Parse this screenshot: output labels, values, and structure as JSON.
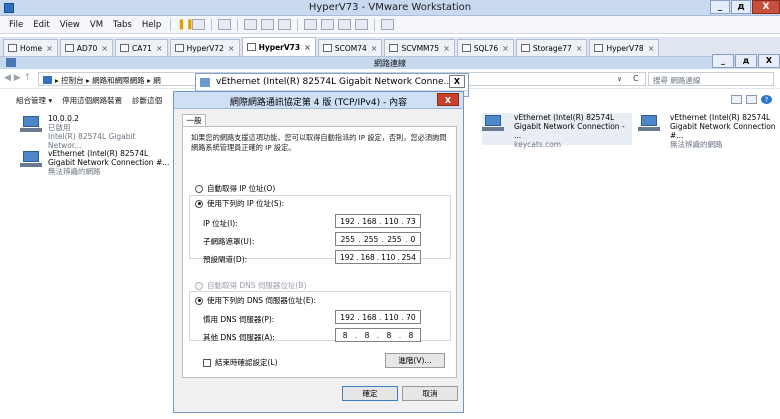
{
  "vmware": {
    "title": "HyperV73 - VMware Workstation",
    "window_controls": {
      "minimize": "_",
      "maximize": "д",
      "close": "X"
    },
    "menu": [
      "File",
      "Edit",
      "View",
      "VM",
      "Tabs",
      "Help"
    ],
    "tabs": [
      {
        "label": "Home",
        "active": false
      },
      {
        "label": "AD70",
        "active": false
      },
      {
        "label": "CA71",
        "active": false
      },
      {
        "label": "HyperV72",
        "active": false
      },
      {
        "label": "HyperV73",
        "active": true
      },
      {
        "label": "SCOM74",
        "active": false
      },
      {
        "label": "SCVMM75",
        "active": false
      },
      {
        "label": "SQL76",
        "active": false
      },
      {
        "label": "Storage77",
        "active": false
      },
      {
        "label": "HyperV78",
        "active": false
      }
    ],
    "tab_close": "×"
  },
  "explorer": {
    "title": "網路連線",
    "window_controls": {
      "minimize": "_",
      "maximize": "д",
      "close": "X"
    },
    "nav": "◀ ▶ ↑",
    "address": "▸ 控制台 ▸ 網路和網際網路 ▸ 網",
    "address_dropdown": "∨",
    "address_refresh": "С",
    "search_placeholder": "搜尋 網路連線",
    "commands": [
      "組合管理 ▾",
      "停用這個網路裝置",
      "診斷這個"
    ],
    "help_label": "?",
    "adapters": [
      {
        "line1": "10.0.0.2",
        "line2": "已啟用",
        "line3": "Intel(R) 82574L Gigabit Networ..."
      },
      {
        "line1": "vEthernet (Intel(R) 82574L",
        "line2": "Gigabit Network Connection #...",
        "line3": "無法辨識的網路"
      },
      {
        "line1": "vEthernet (Intel(R) 82574L",
        "line2": "Gigabit Network Connection - ...",
        "line3": "keycats.com"
      },
      {
        "line1": "vEthernet (Intel(R) 82574L",
        "line2": "Gigabit Network Connection #...",
        "line3": "無法辨識的網路"
      }
    ]
  },
  "status_window": {
    "title": "vEthernet (Intel(R) 82574L Gigabit Network Conne...",
    "close": "X"
  },
  "dialog": {
    "title": "網際網路通訊協定第 4 版 (TCP/IPv4) - 內容",
    "close": "X",
    "tab": "一般",
    "intro": "如果您的網路支援這項功能，您可以取得自動指派的 IP 設定，否則，您必須詢問網路系統管理員正確的 IP 設定。",
    "ip_auto": "自動取得 IP 位址(O)",
    "ip_manual": "使用下列的 IP 位址(S):",
    "ip_label": "IP 位址(I):",
    "ip_value": [
      "192",
      "168",
      "110",
      "73"
    ],
    "mask_label": "子網路遮罩(U):",
    "mask_value": [
      "255",
      "255",
      "255",
      "0"
    ],
    "gateway_label": "預設閘道(D):",
    "gateway_value": [
      "192",
      "168",
      "110",
      "254"
    ],
    "dns_auto": "自動取得 DNS 伺服器位址(B)",
    "dns_manual": "使用下列的 DNS 伺服器位址(E):",
    "dns1_label": "慣用 DNS 伺服器(P):",
    "dns1_value": [
      "192",
      "168",
      "110",
      "70"
    ],
    "dns2_label": "其他 DNS 伺服器(A):",
    "dns2_value": [
      "8",
      "8",
      "8",
      "8"
    ],
    "validate_label": "結束時確認設定(L)",
    "advanced_label": "進階(V)...",
    "ok_label": "確定",
    "cancel_label": "取消"
  }
}
